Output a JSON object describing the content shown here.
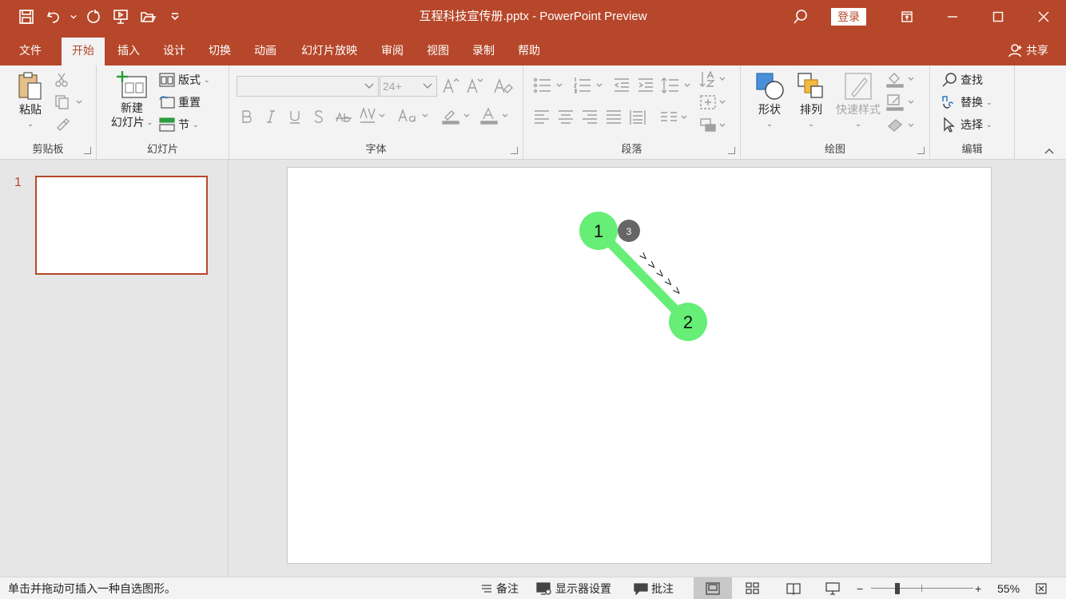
{
  "window": {
    "title": "互程科技宣传册.pptx  -  PowerPoint Preview",
    "login_label": "登录"
  },
  "tabs": [
    {
      "label": "文件"
    },
    {
      "label": "开始"
    },
    {
      "label": "插入"
    },
    {
      "label": "设计"
    },
    {
      "label": "切换"
    },
    {
      "label": "动画"
    },
    {
      "label": "幻灯片放映"
    },
    {
      "label": "审阅"
    },
    {
      "label": "视图"
    },
    {
      "label": "录制"
    },
    {
      "label": "帮助"
    }
  ],
  "active_tab": "开始",
  "share_label": "共享",
  "ribbon": {
    "clipboard": {
      "label": "剪贴板",
      "paste": "粘贴"
    },
    "slides": {
      "label": "幻灯片",
      "new_slide_line1": "新建",
      "new_slide_line2": "幻灯片",
      "layout": "版式",
      "reset": "重置",
      "section": "节"
    },
    "font": {
      "label": "字体",
      "font_name": "",
      "font_size": "24+"
    },
    "paragraph": {
      "label": "段落"
    },
    "drawing": {
      "label": "绘图",
      "shapes": "形状",
      "arrange": "排列",
      "quick_styles": "快速样式"
    },
    "editing": {
      "label": "编辑",
      "find": "查找",
      "replace": "替换",
      "select": "选择"
    }
  },
  "thumbnails": [
    {
      "number": "1"
    }
  ],
  "slide": {
    "node_start_label": "1",
    "node_end_label": "2",
    "badge_label": "3",
    "arrow_marks": "> > > > >",
    "node_color": "#66ee77",
    "badge_color": "#666666"
  },
  "status": {
    "hint": "单击并拖动可插入一种自选图形。",
    "notes": "备注",
    "display_settings": "显示器设置",
    "comments": "批注",
    "zoom_out": "−",
    "zoom_in": "+",
    "zoom": "55%"
  },
  "colors": {
    "accent": "#b7472a"
  }
}
